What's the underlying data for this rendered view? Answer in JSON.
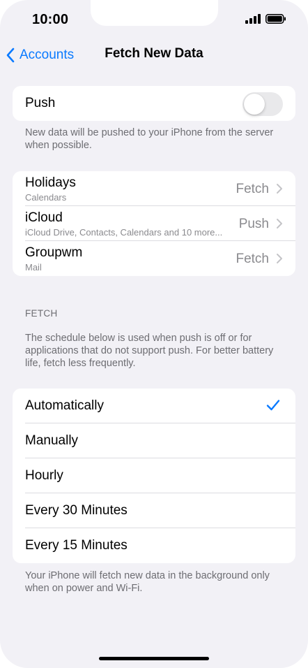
{
  "status_bar": {
    "time": "10:00"
  },
  "nav": {
    "back_label": "Accounts",
    "title": "Fetch New Data"
  },
  "push": {
    "label": "Push",
    "enabled": false,
    "footnote": "New data will be pushed to your iPhone from the server when possible."
  },
  "accounts": [
    {
      "name": "Holidays",
      "detail": "Calendars",
      "value": "Fetch"
    },
    {
      "name": "iCloud",
      "detail": "iCloud Drive, Contacts, Calendars and 10 more...",
      "value": "Push"
    },
    {
      "name": "Groupwm",
      "detail": "Mail",
      "value": "Fetch"
    }
  ],
  "fetch": {
    "header": "FETCH",
    "description": "The schedule below is used when push is off or for applications that do not support push. For better battery life, fetch less frequently.",
    "options": [
      {
        "label": "Automatically",
        "selected": true
      },
      {
        "label": "Manually",
        "selected": false
      },
      {
        "label": "Hourly",
        "selected": false
      },
      {
        "label": "Every 30 Minutes",
        "selected": false
      },
      {
        "label": "Every 15 Minutes",
        "selected": false
      }
    ],
    "footnote": "Your iPhone will fetch new data in the background only when on power and Wi-Fi."
  },
  "colors": {
    "accent": "#0a7aff",
    "background": "#f2f1f6",
    "secondary_text": "#8a8a8e"
  },
  "icons": {
    "back": "chevron-left-icon",
    "disclosure": "chevron-right-icon",
    "check": "checkmark-icon",
    "signal": "cellular-signal-icon",
    "battery": "battery-icon"
  }
}
